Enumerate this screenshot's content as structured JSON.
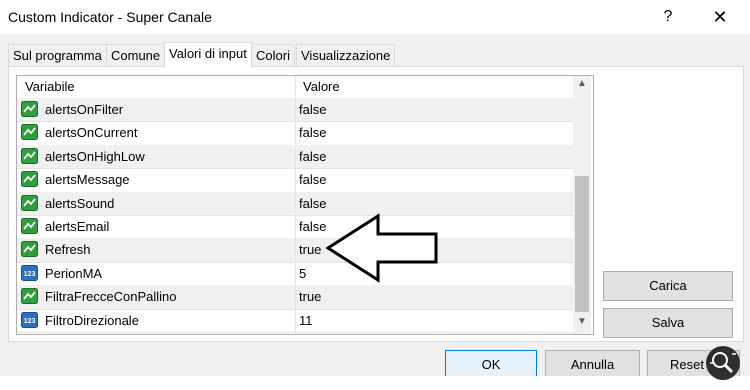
{
  "window": {
    "title": "Custom Indicator - Super Canale"
  },
  "titlebar": {
    "help_glyph": "?",
    "close_glyph": "✕"
  },
  "tabs": [
    {
      "label": "Sul programma",
      "active": false
    },
    {
      "label": "Comune",
      "active": false
    },
    {
      "label": "Valori di input",
      "active": true
    },
    {
      "label": "Colori",
      "active": false
    },
    {
      "label": "Visualizzazione",
      "active": false
    }
  ],
  "grid": {
    "headers": {
      "variable": "Variabile",
      "value": "Valore"
    },
    "rows": [
      {
        "icon": "bool-icon",
        "name": "alertsOnFilter",
        "value": "false"
      },
      {
        "icon": "bool-icon",
        "name": "alertsOnCurrent",
        "value": "false"
      },
      {
        "icon": "bool-icon",
        "name": "alertsOnHighLow",
        "value": "false"
      },
      {
        "icon": "bool-icon",
        "name": "alertsMessage",
        "value": "false"
      },
      {
        "icon": "bool-icon",
        "name": "alertsSound",
        "value": "false"
      },
      {
        "icon": "bool-icon",
        "name": "alertsEmail",
        "value": "false"
      },
      {
        "icon": "bool-icon",
        "name": "Refresh",
        "value": "true"
      },
      {
        "icon": "int-icon",
        "name": "PerionMA",
        "value": "5"
      },
      {
        "icon": "bool-icon",
        "name": "FiltraFrecceConPallino",
        "value": "true"
      },
      {
        "icon": "int-icon",
        "name": "FiltroDirezionale",
        "value": "11"
      }
    ]
  },
  "side_buttons": {
    "load": "Carica",
    "save": "Salva"
  },
  "footer_buttons": {
    "ok": "OK",
    "cancel": "Annulla",
    "reset": "Reset"
  },
  "int_icon_text": "123",
  "colors": {
    "bool_icon": "#2e9e3e",
    "int_icon": "#2f6fc1",
    "arrow": "#000000"
  }
}
